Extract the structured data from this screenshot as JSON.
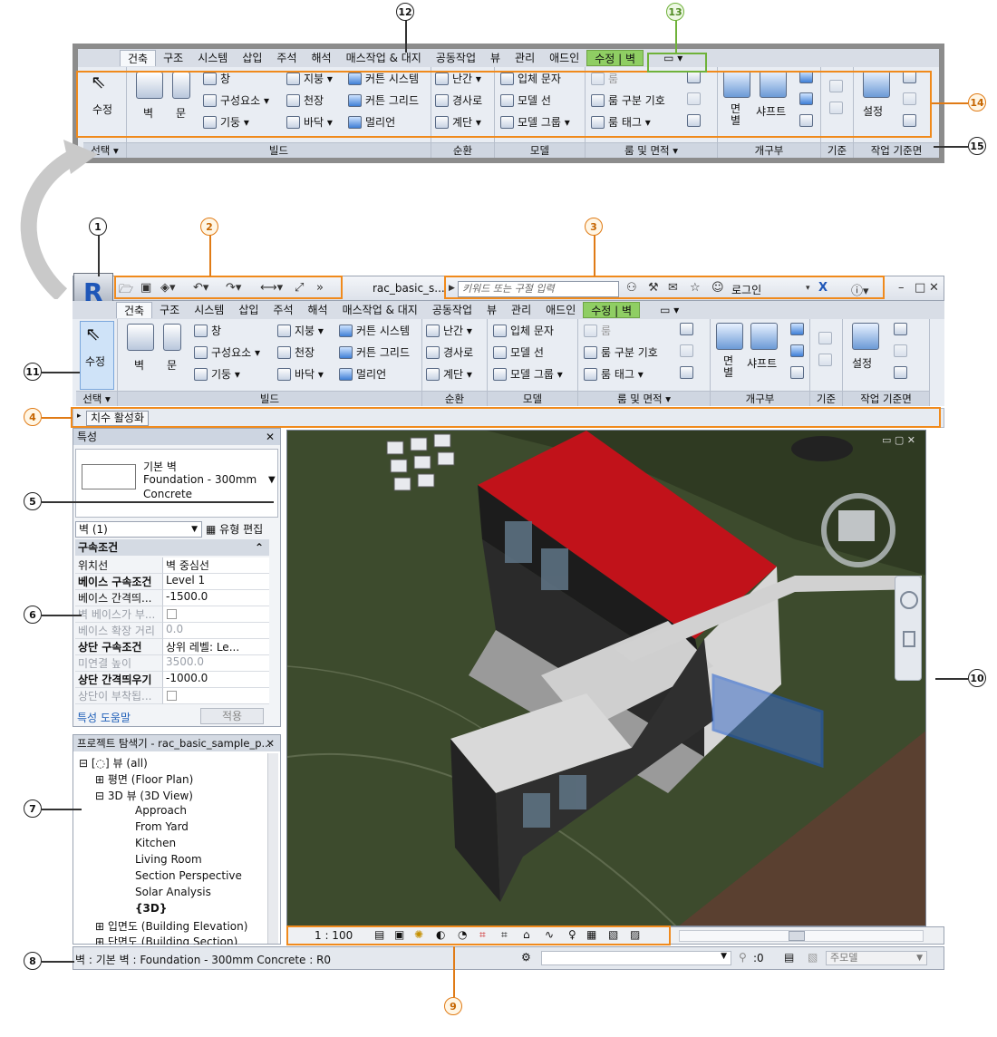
{
  "colors": {
    "callout_orange": "#f08a1c",
    "context_tab": "#8fce63",
    "roof": "#c1121a"
  },
  "callouts": {
    "c1": "1",
    "c2": "2",
    "c3": "3",
    "c4": "4",
    "c5": "5",
    "c6": "6",
    "c7": "7",
    "c8": "8",
    "c9": "9",
    "c10": "10",
    "c11": "11",
    "c12": "12",
    "c13": "13",
    "c14": "14",
    "c15": "15"
  },
  "tabs": [
    "건축",
    "구조",
    "시스템",
    "삽입",
    "주석",
    "해석",
    "매스작업 & 대지",
    "공동작업",
    "뷰",
    "관리",
    "애드인"
  ],
  "context_tab": "수정 | 벽",
  "ribbon": {
    "modify": "수정",
    "select": "선택 ▾",
    "wall": "벽",
    "door": "문",
    "window": "창",
    "component": "구성요소 ▾",
    "column": "기둥 ▾",
    "roof": "지붕 ▾",
    "ceiling": "천장",
    "floor": "바닥 ▾",
    "curtain_system": "커튼 시스템",
    "curtain_grid": "커튼 그리드",
    "mullion": "멀리언",
    "railing": "난간 ▾",
    "ramp": "경사로",
    "stair": "계단 ▾",
    "model_text": "입체 문자",
    "model_line": "모델 선",
    "model_group": "모델 그룹 ▾",
    "room": "룸",
    "room_separator": "룸 구분 기호",
    "room_tag": "룸 태그 ▾",
    "by_face": "면\n별",
    "shaft": "샤프트",
    "set": "설정",
    "panel_build": "빌드",
    "panel_circulation": "순환",
    "panel_model": "모델",
    "panel_room": "룸 및 면적 ▾",
    "panel_opening": "개구부",
    "panel_datum": "기준",
    "panel_workplane": "작업 기준면"
  },
  "titlebar": {
    "filename": "rac_basic_s...",
    "search_placeholder": "키워드 또는 구절 입력",
    "login": "로그인"
  },
  "option_bar": {
    "label": "치수 활성화"
  },
  "properties": {
    "title": "특성",
    "type_family": "기본 벽",
    "type_name": "Foundation - 300mm",
    "type_material": "Concrete",
    "filter": "벽 (1)",
    "edit_type": "유형 편집",
    "group": "구속조건",
    "rows": [
      {
        "k": "위치선",
        "v": "벽 중심선"
      },
      {
        "k": "베이스 구속조건",
        "v": "Level 1"
      },
      {
        "k": "베이스 간격띄...",
        "v": "-1500.0"
      },
      {
        "k": "벽 베이스가 부...",
        "v": ""
      },
      {
        "k": "베이스 확장 거리",
        "v": "0.0"
      },
      {
        "k": "상단 구속조건",
        "v": "상위 레벨: Le..."
      },
      {
        "k": "미연결 높이",
        "v": "3500.0"
      },
      {
        "k": "상단 간격띄우기",
        "v": "-1000.0"
      },
      {
        "k": "상단이 부착됩...",
        "v": ""
      }
    ],
    "help": "특성 도움말",
    "apply": "적용"
  },
  "browser": {
    "title": "프로젝트 탐색기 - rac_basic_sample_p...",
    "items": [
      "뷰 (all)",
      "평면 (Floor Plan)",
      "3D 뷰 (3D View)",
      "Approach",
      "From Yard",
      "Kitchen",
      "Living Room",
      "Section Perspective",
      "Solar Analysis",
      "{3D}",
      "입면도 (Building Elevation)",
      "단면도 (Building Section)"
    ]
  },
  "view_bar": {
    "scale": "1 : 100"
  },
  "status": {
    "text": "벽 : 기본 벽 : Foundation - 300mm Concrete : R0",
    "count": ":0",
    "model": "주모델"
  }
}
